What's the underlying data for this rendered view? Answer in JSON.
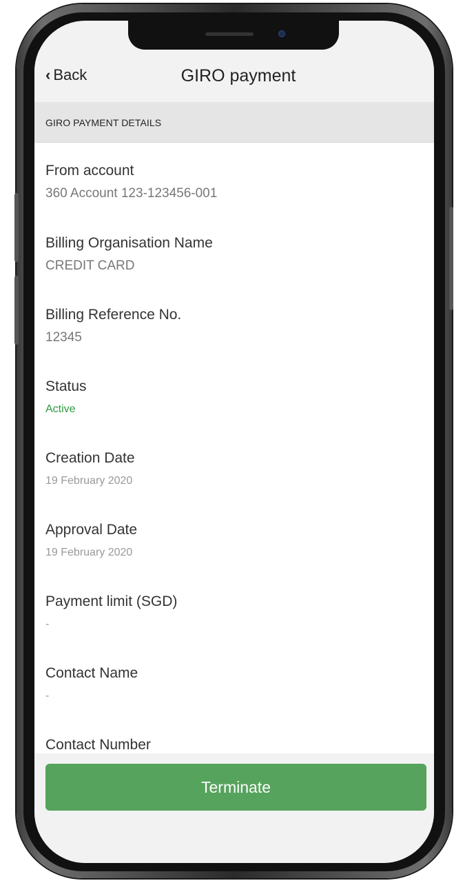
{
  "nav": {
    "back_label": "Back",
    "title": "GIRO payment"
  },
  "section": {
    "header": "GIRO PAYMENT DETAILS"
  },
  "fields": [
    {
      "label": "From account",
      "value": "360 Account 123-123456-001"
    },
    {
      "label": "Billing Organisation Name",
      "value": "CREDIT CARD"
    },
    {
      "label": "Billing Reference No.",
      "value": "12345"
    },
    {
      "label": "Status",
      "value": "Active"
    },
    {
      "label": "Creation Date",
      "value": "19 February 2020"
    },
    {
      "label": "Approval Date",
      "value": "19 February 2020"
    },
    {
      "label": "Payment limit (SGD)",
      "value": "-"
    },
    {
      "label": "Contact Name",
      "value": "-"
    },
    {
      "label": "Contact Number",
      "value": "-"
    }
  ],
  "actions": {
    "terminate_label": "Terminate"
  },
  "colors": {
    "accent": "#55a35c",
    "status_active": "#2e9a3e"
  }
}
